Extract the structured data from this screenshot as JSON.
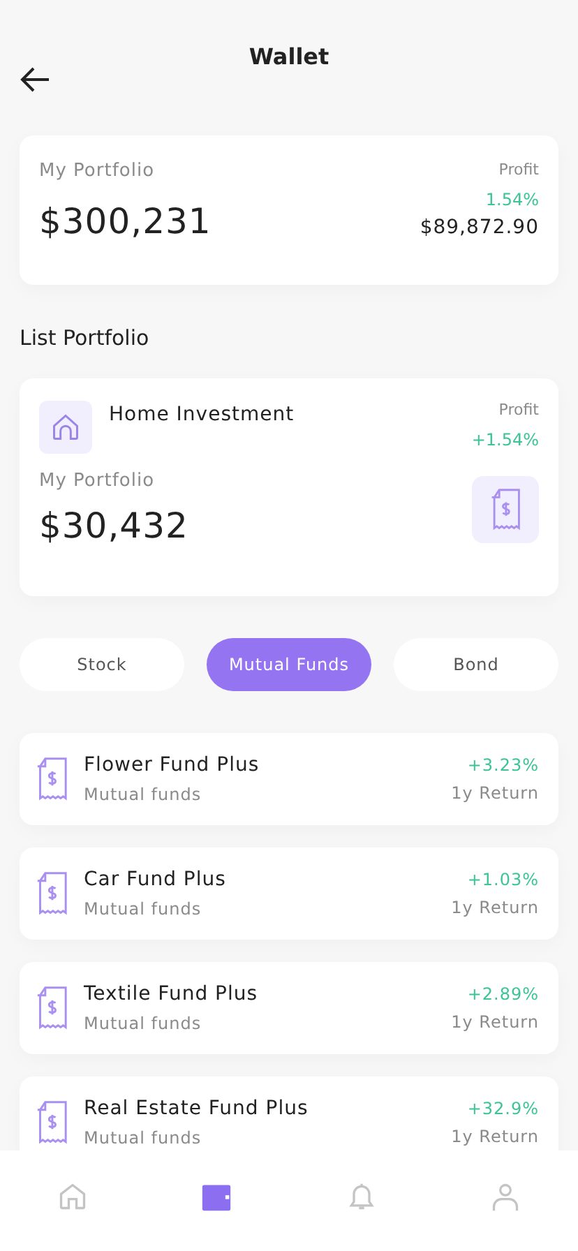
{
  "header": {
    "title": "Wallet"
  },
  "summary": {
    "label": "My Portfolio",
    "value": "$300,231",
    "profit_label": "Profit",
    "profit_percent": "1.54%",
    "profit_amount": "$89,872.90"
  },
  "section_title": "List Portfolio",
  "portfolio": {
    "name": "Home Investment",
    "profit_label": "Profit",
    "profit_percent": "+1.54%",
    "label": "My Portfolio",
    "value": "$30,432"
  },
  "tabs": [
    {
      "label": "Stock",
      "selected": false
    },
    {
      "label": "Mutual Funds",
      "selected": true
    },
    {
      "label": "Bond",
      "selected": false
    }
  ],
  "funds": [
    {
      "name": "Flower Fund Plus",
      "type": "Mutual funds",
      "change": "+3.23%",
      "period": "1y Return"
    },
    {
      "name": "Car Fund Plus",
      "type": "Mutual funds",
      "change": "+1.03%",
      "period": "1y Return"
    },
    {
      "name": "Textile Fund Plus",
      "type": "Mutual funds",
      "change": "+2.89%",
      "period": "1y Return"
    },
    {
      "name": "Real Estate Fund Plus",
      "type": "Mutual funds",
      "change": "+32.9%",
      "period": "1y Return"
    }
  ],
  "nav": [
    {
      "kind": "home",
      "selected": false
    },
    {
      "kind": "wallet",
      "selected": true
    },
    {
      "kind": "bell",
      "selected": false
    },
    {
      "kind": "profile",
      "selected": false
    }
  ]
}
